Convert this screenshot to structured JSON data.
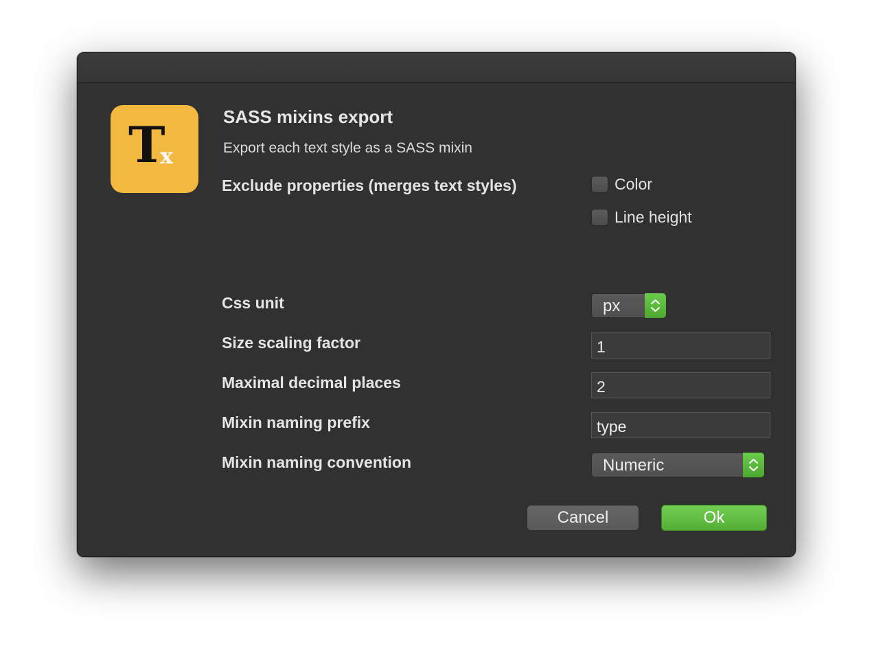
{
  "dialog": {
    "title": "SASS mixins export",
    "subtitle": "Export each text style as a SASS mixin",
    "icon": {
      "glyph_main": "T",
      "glyph_sub": "x",
      "color": "#f2b840"
    }
  },
  "exclude": {
    "label": "Exclude properties (merges text styles)",
    "options": [
      {
        "label": "Color",
        "checked": false
      },
      {
        "label": "Line height",
        "checked": false
      }
    ]
  },
  "css_unit": {
    "label": "Css unit",
    "value": "px"
  },
  "size_scaling": {
    "label": "Size scaling factor",
    "value": "1"
  },
  "decimal_places": {
    "label": "Maximal decimal places",
    "value": "2"
  },
  "naming_prefix": {
    "label": "Mixin naming prefix",
    "value": "type"
  },
  "naming_convention": {
    "label": "Mixin naming convention",
    "value": "Numeric"
  },
  "buttons": {
    "cancel": "Cancel",
    "ok": "Ok"
  },
  "colors": {
    "accent": "#5ab83b",
    "window_bg": "#313131"
  }
}
